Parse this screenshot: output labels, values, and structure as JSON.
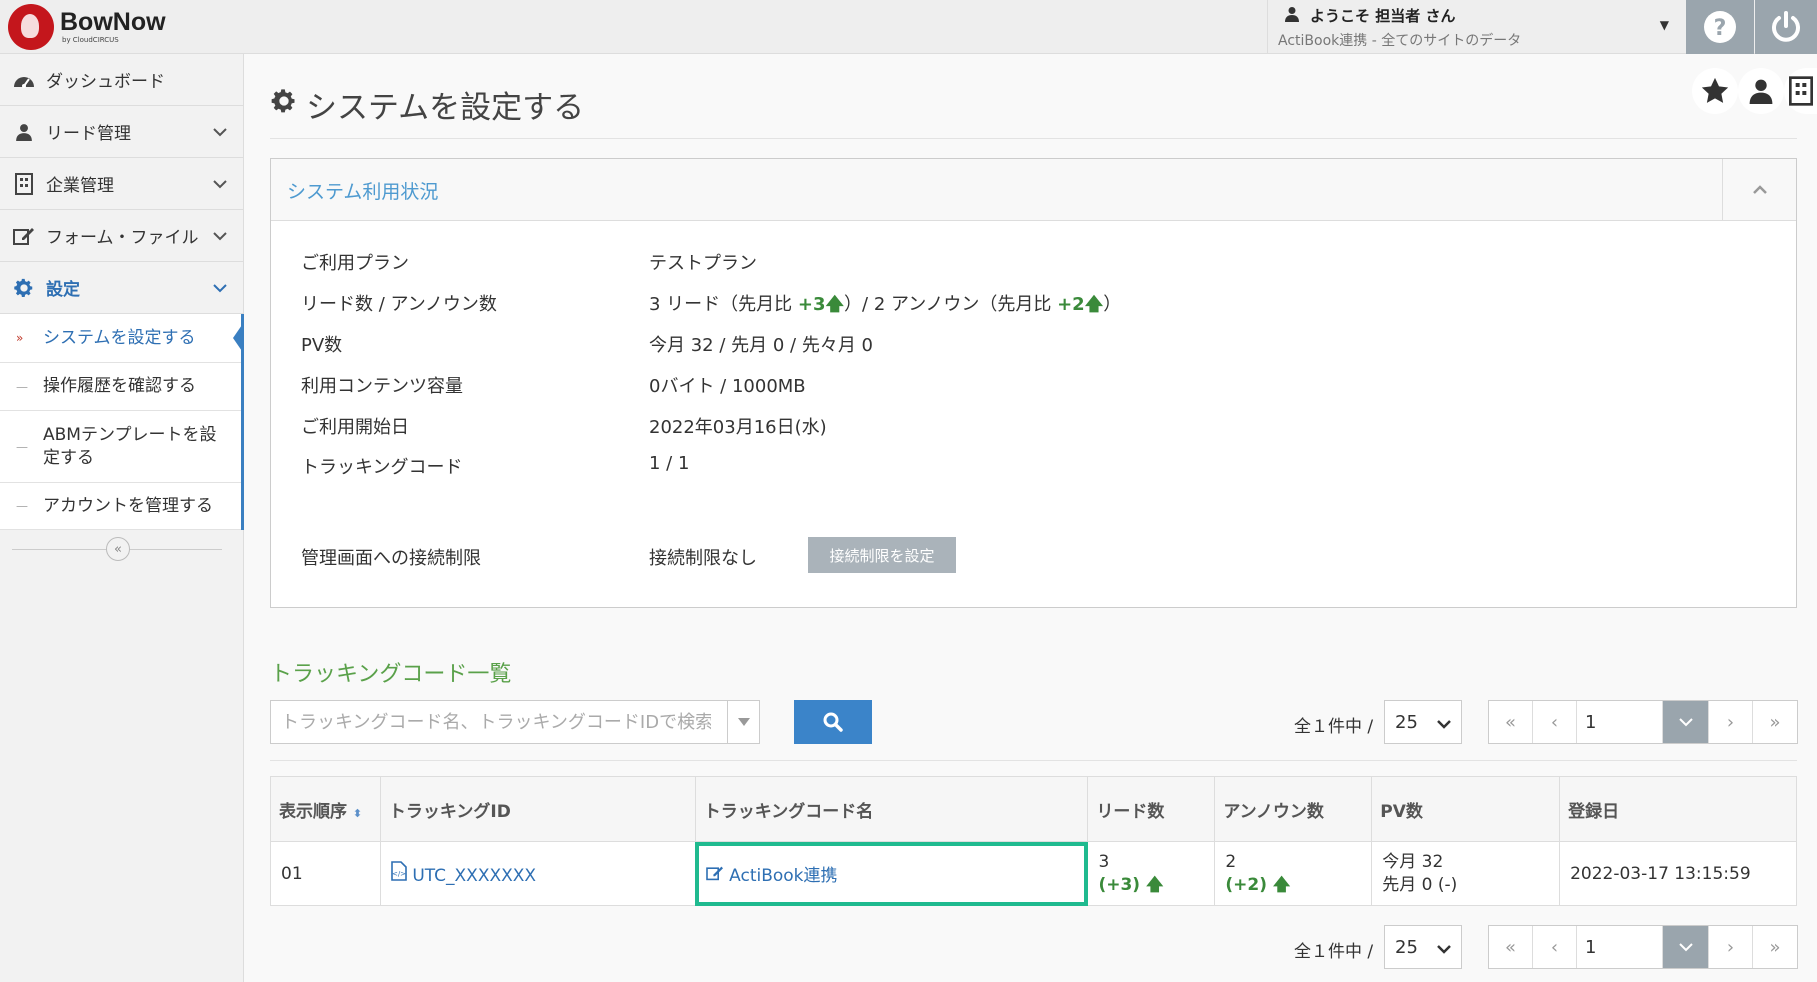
{
  "header": {
    "logo_name": "BowNow",
    "logo_by": "by CloudCIRCUS",
    "welcome": "ようこそ 担当者 さん",
    "site": "ActiBook連携 -  全てのサイトのデータ"
  },
  "sidebar": {
    "items": [
      {
        "label": "ダッシュボード",
        "icon": "dashboard-icon"
      },
      {
        "label": "リード管理",
        "icon": "user-icon"
      },
      {
        "label": "企業管理",
        "icon": "building-icon"
      },
      {
        "label": "フォーム・ファイル",
        "icon": "edit-icon"
      },
      {
        "label": "設定",
        "icon": "gear-icon"
      }
    ],
    "sub_items": [
      {
        "label": "システムを設定する"
      },
      {
        "label": "操作履歴を確認する"
      },
      {
        "label": "ABMテンプレートを設定する"
      },
      {
        "label": "アカウントを管理する"
      }
    ]
  },
  "page": {
    "title": "システムを設定する"
  },
  "usage_panel": {
    "title": "システム利用状況",
    "rows": [
      {
        "label": "ご利用プラン",
        "value": "テストプラン"
      },
      {
        "label": "リード数 / アンノウン数",
        "value_a": "3 リード（先月比 ",
        "up_a": "+3",
        "value_b": "）/  2 アンノウン（先月比 ",
        "up_b": "+2",
        "value_c": "）"
      },
      {
        "label": "PV数",
        "value": "今月 32  /  先月 0 /  先々月 0"
      },
      {
        "label": "利用コンテンツ容量",
        "value": "0バイト  /  1000MB"
      },
      {
        "label": "ご利用開始日",
        "value": "2022年03月16日(水)"
      },
      {
        "label": "トラッキングコード",
        "value": "1  /  1"
      },
      {
        "label": "管理画面への接続制限",
        "value": "接続制限なし"
      }
    ],
    "restrict_button": "接続制限を設定"
  },
  "tracking": {
    "title": "トラッキングコード一覧",
    "search_placeholder": "トラッキングコード名、トラッキングコードIDで検索",
    "count_text": "全１件中 /",
    "per_page": "25",
    "page_value": "1",
    "pager": {
      "first": "«",
      "prev": "‹",
      "next": "›",
      "last": "»"
    },
    "columns": [
      "表示順序",
      "トラッキングID",
      "トラッキングコード名",
      "リード数",
      "アンノウン数",
      "PV数",
      "登録日"
    ],
    "rows": [
      {
        "order": "01",
        "tracking_id": "UTC_XXXXXXX",
        "name": "ActiBook連携",
        "leads": "3",
        "leads_diff": "(+3)",
        "unknown": "2",
        "unknown_diff": "(+2)",
        "pv_this": "今月 32",
        "pv_last": "先月 0 (-)",
        "date": "2022-03-17 13:15:59"
      }
    ]
  },
  "colors": {
    "accent": "#3b84c9",
    "highlight": "#1fba8f",
    "up_green": "#3a8a3a",
    "section_green": "#5aa14a"
  }
}
